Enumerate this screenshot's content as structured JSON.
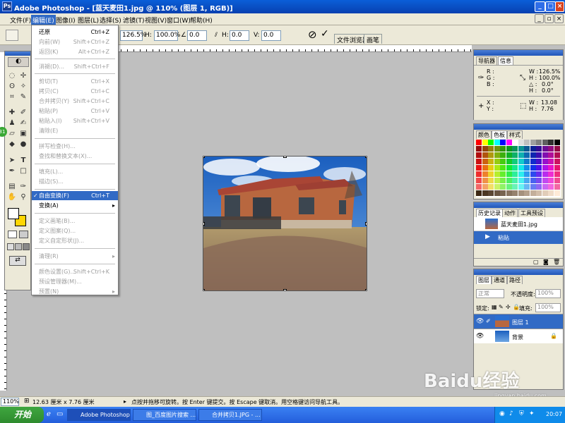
{
  "window": {
    "title": "Adobe Photoshop - [蓝天麦田1.jpg @ 110% (图层 1, RGB)]",
    "min": "_",
    "max": "□",
    "close": "×"
  },
  "menu": [
    "文件(F)",
    "编辑(E)",
    "图像(I)",
    "图层(L)",
    "选择(S)",
    "滤镜(T)",
    "视图(V)",
    "窗口(W)",
    "帮助(H)"
  ],
  "options": {
    "w_value": "126.5%",
    "h_label": "H:",
    "h_value": "100.0%",
    "angle": "0.0",
    "hskew_label": "H:",
    "hskew": "0.0",
    "vskew_label": "V:",
    "vskew": "0.0",
    "cancel": "⊘",
    "commit": "✓",
    "tab_browser": "文件浏览器",
    "tab_brush": "画笔"
  },
  "edit_menu": {
    "items": [
      {
        "label": "还原",
        "shortcut": "Ctrl+Z",
        "disabled": false
      },
      {
        "label": "向前(W)",
        "shortcut": "Shift+Ctrl+Z",
        "disabled": true
      },
      {
        "label": "返回(K)",
        "shortcut": "Alt+Ctrl+Z",
        "disabled": true
      },
      {
        "label": "消褪(D)...",
        "shortcut": "Shift+Ctrl+F",
        "disabled": true
      },
      {
        "label": "剪切(T)",
        "shortcut": "Ctrl+X",
        "disabled": true
      },
      {
        "label": "拷贝(C)",
        "shortcut": "Ctrl+C",
        "disabled": true
      },
      {
        "label": "合并拷贝(Y)",
        "shortcut": "Shift+Ctrl+C",
        "disabled": true
      },
      {
        "label": "粘贴(P)",
        "shortcut": "Ctrl+V",
        "disabled": true
      },
      {
        "label": "粘贴入(I)",
        "shortcut": "Shift+Ctrl+V",
        "disabled": true
      },
      {
        "label": "清除(E)",
        "shortcut": "",
        "disabled": true
      },
      {
        "label": "拼写检查(H)...",
        "shortcut": "",
        "disabled": true
      },
      {
        "label": "查找和替换文本(X)...",
        "shortcut": "",
        "disabled": true
      },
      {
        "label": "填充(L)...",
        "shortcut": "",
        "disabled": true
      },
      {
        "label": "描边(S)...",
        "shortcut": "",
        "disabled": true
      },
      {
        "label": "自由变换(F)",
        "shortcut": "Ctrl+T",
        "disabled": false,
        "selected": true
      },
      {
        "label": "变换(A)",
        "shortcut": "",
        "disabled": false,
        "submenu": true
      },
      {
        "label": "定义画笔(B)...",
        "shortcut": "",
        "disabled": true
      },
      {
        "label": "定义图案(Q)...",
        "shortcut": "",
        "disabled": true
      },
      {
        "label": "定义自定形状(J)...",
        "shortcut": "",
        "disabled": true
      },
      {
        "label": "清理(R)",
        "shortcut": "",
        "disabled": true,
        "submenu": true
      },
      {
        "label": "颜色设置(G)...",
        "shortcut": "Shift+Ctrl+K",
        "disabled": true
      },
      {
        "label": "预设管理器(M)...",
        "shortcut": "",
        "disabled": true
      },
      {
        "label": "预置(N)",
        "shortcut": "",
        "disabled": true,
        "submenu": true
      }
    ],
    "check": "✓",
    "arrow": "▸"
  },
  "navigator": {
    "tab_nav": "导航器",
    "tab_info": "信息",
    "r": "R :",
    "g": "G :",
    "b": "B :",
    "w": "W :",
    "w_val": "126.5%",
    "h": "H :",
    "h_val": "100.0%",
    "a": "△ :",
    "a_val": "0.0°",
    "h2": "H :",
    "h2_val": "0.0°",
    "x": "X :",
    "y": "Y :",
    "w2": "W :",
    "w2_val": "13.08",
    "h3": "H :",
    "h3_val": "7.76"
  },
  "color": {
    "tab_color": "颜色",
    "tab_swatch": "色板",
    "tab_style": "样式"
  },
  "history": {
    "tab_history": "历史记录",
    "tab_actions": "动作",
    "tab_presets": "工具预设",
    "snapshot": "蓝天麦田1.jpg",
    "step": "粘贴"
  },
  "layers": {
    "tab_layers": "图层",
    "tab_channels": "通道",
    "tab_paths": "路径",
    "blend": "正常",
    "opacity_label": "不透明度:",
    "opacity": "100%",
    "lock_label": "锁定:",
    "fill_label": "填充:",
    "fill": "100%",
    "layer1": "图层 1",
    "background": "背景"
  },
  "status": {
    "zoom": "110%",
    "size": "12.63 厘米 x 7.76 厘米",
    "hint": "点按并拖移可旋转。按 Enter 键提交。按 Escape 键取消。用空格键访问导航工具。"
  },
  "taskbar": {
    "start": "开始",
    "tasks": [
      "Adobe Photoshop ...",
      "图_百度图片搜索 ...",
      "合并拷贝1.JPG - ..."
    ],
    "clock": "20:07"
  },
  "watermark": {
    "main": "Baidu经验",
    "sub": "jingyan.baidu.com"
  },
  "colors": {
    "title_blue": "#0a5fd8",
    "menu_bg": "#ece9d8",
    "highlight": "#316ac5",
    "canvas_gray": "#bfbfbf"
  }
}
